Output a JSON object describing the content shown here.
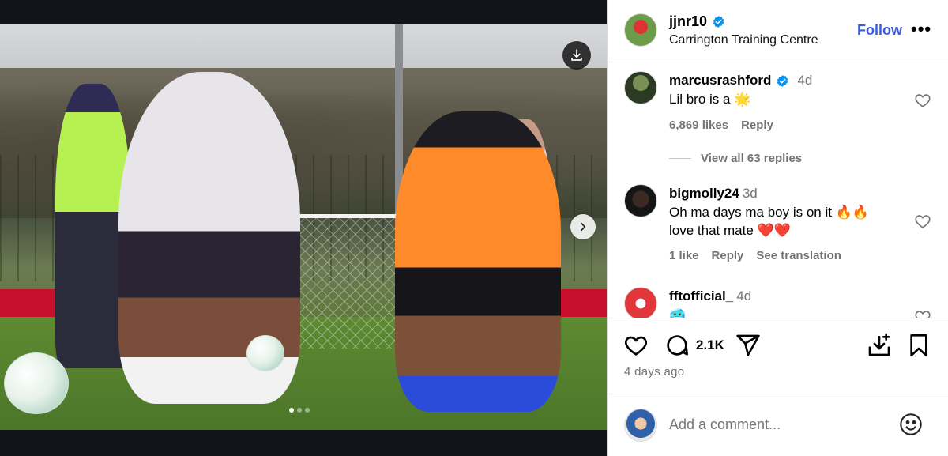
{
  "post": {
    "username": "jjnr10",
    "location": "Carrington Training Centre",
    "follow_label": "Follow",
    "more_label": "•••",
    "likes": "2.1K",
    "time_ago": "4 days ago"
  },
  "media": {
    "slide_count": 3,
    "active_slide": 1
  },
  "comments": [
    {
      "username": "marcusrashford",
      "verified": true,
      "time": "4d",
      "text": "Lil bro is a 🌟",
      "likes": "6,869 likes",
      "reply_label": "Reply",
      "view_replies": "View all 63 replies"
    },
    {
      "username": "bigmolly24",
      "verified": false,
      "time": "3d",
      "text_line1": "Oh ma days ma boy is on it 🔥🔥",
      "text_line2": "love that mate ❤️❤️",
      "likes": "1 like",
      "reply_label": "Reply",
      "translate_label": "See translation"
    },
    {
      "username": "fftofficial_",
      "verified": false,
      "time": "4d",
      "text": "🥶"
    }
  ],
  "add_comment": {
    "placeholder": "Add a comment..."
  },
  "colors": {
    "verified": "#0095f6",
    "follow": "#3b5bdb",
    "secondary_text": "#737373"
  },
  "icons": {
    "download": "download-icon",
    "next": "chevron-right-icon",
    "like": "heart-icon",
    "comment": "comment-icon",
    "share": "send-icon",
    "save_collection": "save-to-collection-icon",
    "bookmark": "bookmark-icon",
    "emoji": "emoji-icon"
  }
}
